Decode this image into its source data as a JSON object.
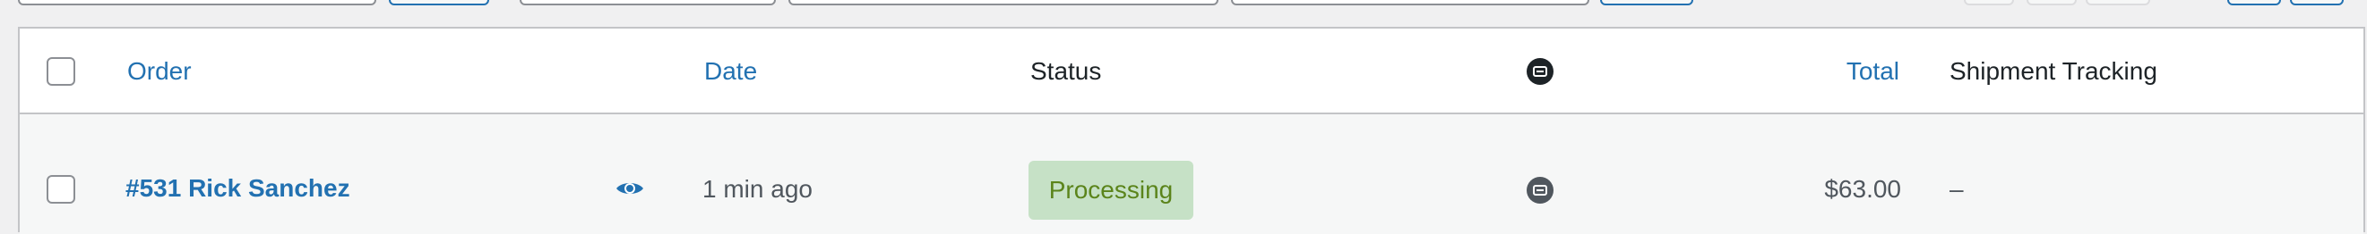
{
  "table": {
    "columns": {
      "order": "Order",
      "date": "Date",
      "status": "Status",
      "actions_icon": "actions-icon",
      "total": "Total",
      "shipment_tracking": "Shipment Tracking"
    },
    "rows": [
      {
        "order": "#531 Rick Sanchez",
        "date": "1 min ago",
        "status": "Processing",
        "total": "$63.00",
        "shipment_tracking": "–"
      }
    ]
  },
  "colors": {
    "link": "#2271b1",
    "status_processing_bg": "#c6e1c6",
    "status_processing_text": "#5b841b",
    "row_bg": "#f6f7f7",
    "border": "#c3c4c7"
  },
  "icons": {
    "preview": "eye-icon",
    "header_action": "circle-action-icon",
    "row_action": "circle-action-icon"
  }
}
